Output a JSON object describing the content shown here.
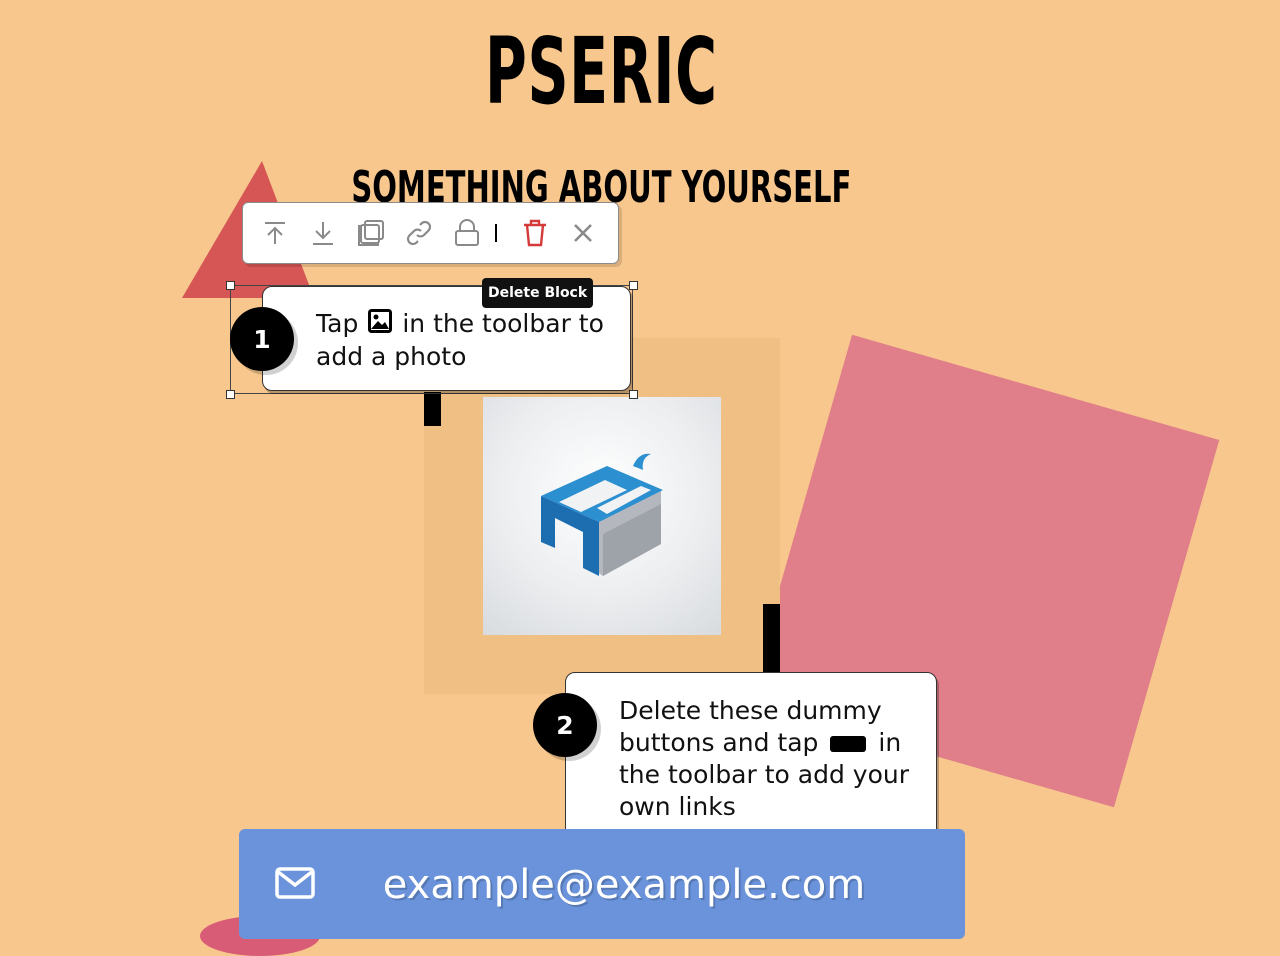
{
  "header": {
    "title": "PSERIC",
    "subtitle": "SOMETHING ABOUT YOURSELF"
  },
  "toolbar": {
    "buttons": [
      "move-to-top-icon",
      "move-to-bottom-icon",
      "duplicate-icon",
      "link-icon",
      "lock-icon",
      "delete-icon",
      "close-icon"
    ],
    "tooltip": "Delete Block"
  },
  "tips": [
    {
      "number": "1",
      "text_before": "Tap",
      "icon": "image-icon",
      "text_after": "in the toolbar to add a photo"
    },
    {
      "number": "2",
      "text_before": "Delete these dummy buttons and tap",
      "icon": "button-icon",
      "text_after": "in the toolbar to add your own links"
    }
  ],
  "email_button": {
    "icon": "mail-icon",
    "label": "example@example.com"
  },
  "colors": {
    "background": "#f7c78d",
    "triangle": "#d65555",
    "pink_square": "#e07e8a",
    "photo_frame": "#f0bf84",
    "email_button": "#6a93db",
    "delete_red": "#d43a3a"
  }
}
